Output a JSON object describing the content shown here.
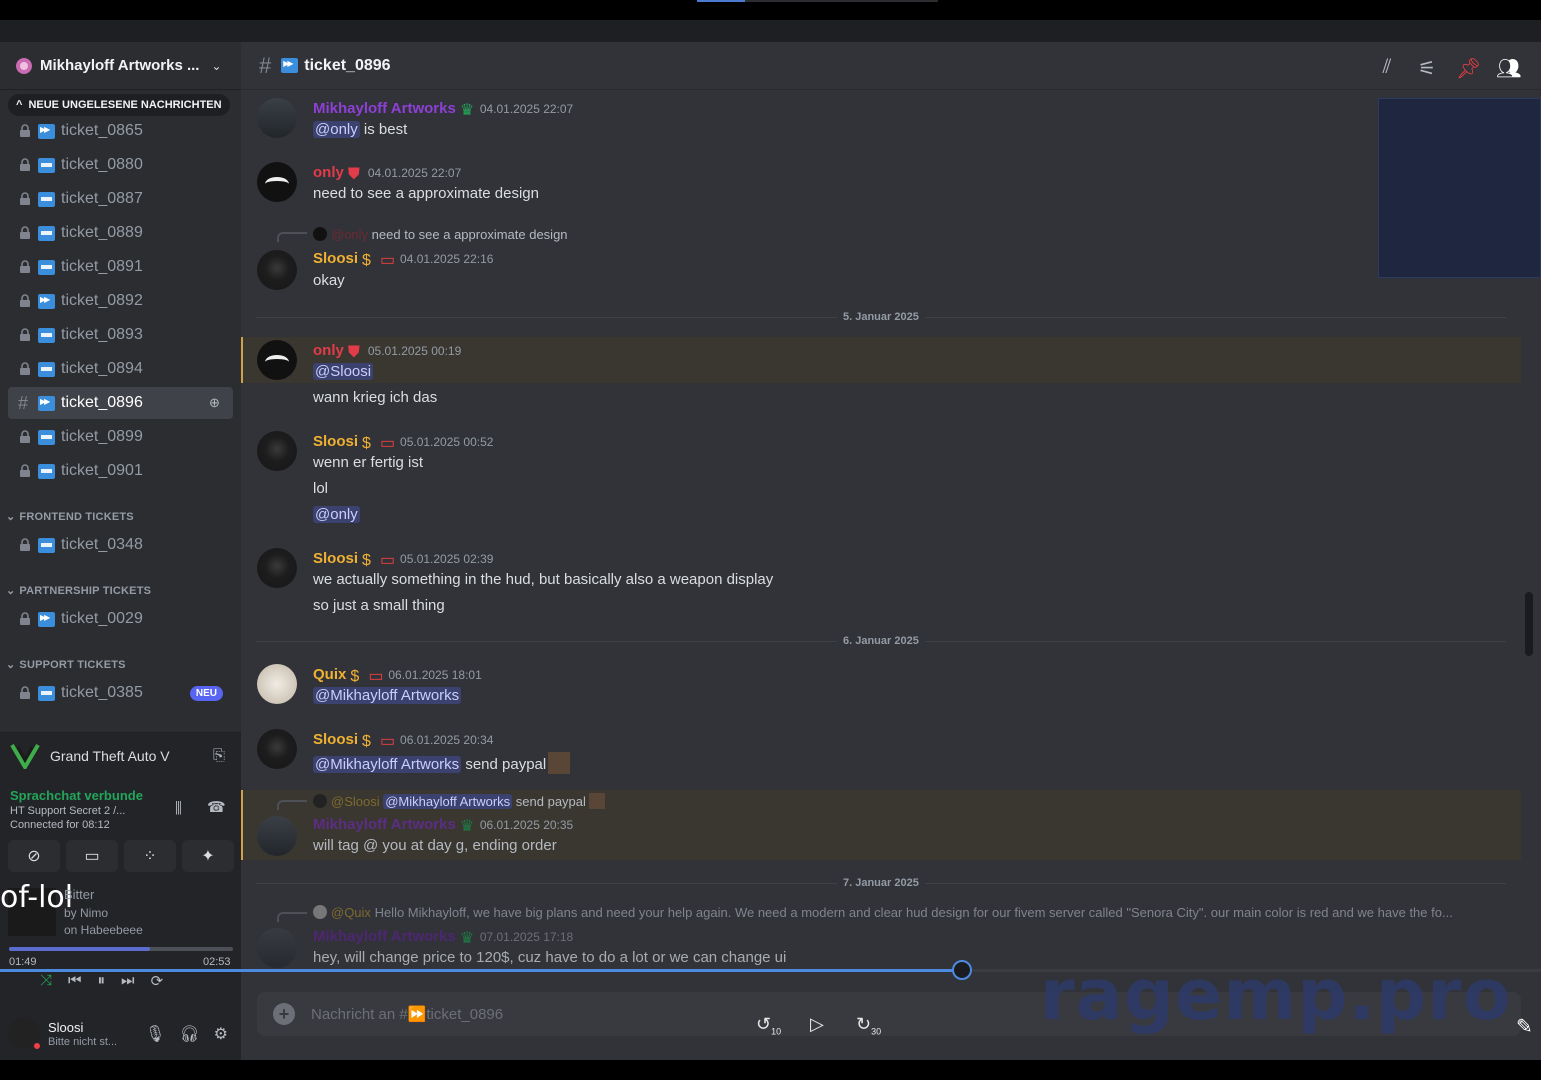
{
  "server": {
    "name": "Mikhayloff Artworks ..."
  },
  "unread_pill": "NEUE UNGELESENE NACHRICHTEN",
  "channels": [
    {
      "name": "ticket_0865",
      "badge": "fwd"
    },
    {
      "name": "ticket_0880",
      "badge": "new"
    },
    {
      "name": "ticket_0887",
      "badge": "new"
    },
    {
      "name": "ticket_0889",
      "badge": "new"
    },
    {
      "name": "ticket_0891",
      "badge": "new"
    },
    {
      "name": "ticket_0892",
      "badge": "fwd"
    },
    {
      "name": "ticket_0893",
      "badge": "new"
    },
    {
      "name": "ticket_0894",
      "badge": "new"
    },
    {
      "name": "ticket_0896",
      "badge": "fwd"
    },
    {
      "name": "ticket_0899",
      "badge": "new"
    },
    {
      "name": "ticket_0901",
      "badge": "new"
    }
  ],
  "categories": {
    "frontend": {
      "label": "FRONTEND TICKETS",
      "channel": "ticket_0348"
    },
    "partnership": {
      "label": "PARTNERSHIP TICKETS",
      "channel": "ticket_0029"
    },
    "support": {
      "label": "SUPPORT TICKETS",
      "channel": "ticket_0385",
      "badge": "NEU"
    }
  },
  "activity": {
    "game": "Grand Theft Auto V"
  },
  "voice": {
    "status": "Sprachchat verbunde",
    "channel": "HT Support Secret 2 /...",
    "time": "Connected for 08:12"
  },
  "music": {
    "overlay": "of-lol",
    "song": "Bitter",
    "artist": "by Nimo",
    "album": "on Habeebeee",
    "elapsed": "01:49",
    "total": "02:53",
    "progress": 0.63
  },
  "user": {
    "name": "Sloosi",
    "status": "Bitte nicht st..."
  },
  "header": {
    "channel": "ticket_0896"
  },
  "dividers": {
    "d5": "5. Januar 2025",
    "d6": "6. Januar 2025",
    "d7": "7. Januar 2025"
  },
  "messages": {
    "m1": {
      "user": "Mikhayloff Artworks",
      "time": "04.01.2025 22:07",
      "mention": "@only",
      "text": " is best"
    },
    "m2": {
      "user": "only",
      "time": "04.01.2025 22:07",
      "text": "need to see a approximate design"
    },
    "m3": {
      "reply_user": "@only",
      "reply_text": "need to see a approximate design",
      "user": "Sloosi",
      "time": "04.01.2025 22:16",
      "text": "okay"
    },
    "m4": {
      "user": "only",
      "time": "05.01.2025 00:19",
      "mention": "@Sloosi",
      "text": "wann krieg ich das"
    },
    "m5": {
      "user": "Sloosi",
      "time": "05.01.2025 00:52",
      "text1": "wenn er fertig ist",
      "text2": "lol",
      "mention": "@only"
    },
    "m6": {
      "user": "Sloosi",
      "time": "05.01.2025 02:39",
      "text1": "we actually something in the hud, but basically also a weapon display",
      "text2": "so just a small thing"
    },
    "m7": {
      "user": "Quix",
      "time": "06.01.2025 18:01",
      "mention": "@Mikhayloff Artworks"
    },
    "m8": {
      "user": "Sloosi",
      "time": "06.01.2025 20:34",
      "mention": "@Mikhayloff Artworks",
      "text": " send paypal"
    },
    "m9": {
      "reply_user": "@Sloosi",
      "reply_mention": "@Mikhayloff Artworks",
      "reply_text": "send paypal",
      "user": "Mikhayloff Artworks",
      "time": "06.01.2025 20:35",
      "text": "will tag @ you at day g, ending order"
    },
    "m10": {
      "reply_user": "@Quix",
      "reply_text": "Hello Mikhayloff,  we have big plans and need your help again. We need a modern and clear hud design for our fivem server called \"Senora City\". our main color is red and we have the fo...",
      "user": "Mikhayloff Artworks",
      "time": "07.01.2025 17:18",
      "text": "hey, will change price to 120$, cuz have to do a lot or we can change ui"
    }
  },
  "composer": {
    "placeholder": "Nachricht an #⏩ticket_0896"
  },
  "video": {
    "back": "10",
    "forward": "30",
    "progress": 0.624
  },
  "watermark": "ragemp.pro",
  "colors": {
    "mikhayloff": "#8e3fd6",
    "only": "#e23b4a",
    "sloosi": "#f0b132",
    "quix": "#f0b132",
    "mention_bg": "#3c4270",
    "highlight": "#3a3731"
  }
}
